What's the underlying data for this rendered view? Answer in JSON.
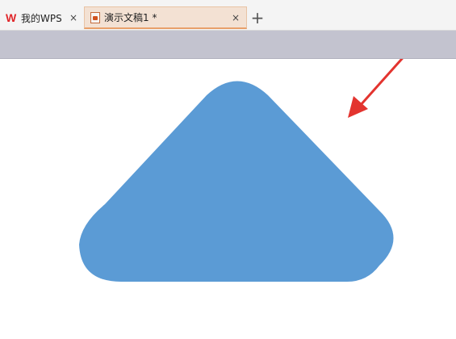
{
  "tabs": [
    {
      "label": "我的WPS",
      "close": "×",
      "icon": "wps-logo-icon"
    },
    {
      "label": "演示文稿1 *",
      "close": "×",
      "icon": "presentation-doc-icon",
      "active": true
    }
  ],
  "new_tab_label": "+",
  "wps_logo_text": "W",
  "colors": {
    "shape_fill": "#5b9bd5",
    "arrow": "#e3342f",
    "toolbar": "#c3c3cf",
    "active_tab": "#f3e1d3"
  },
  "slide": {
    "shape": "rounded-triangle",
    "annotation": "red-arrow-pointer"
  }
}
